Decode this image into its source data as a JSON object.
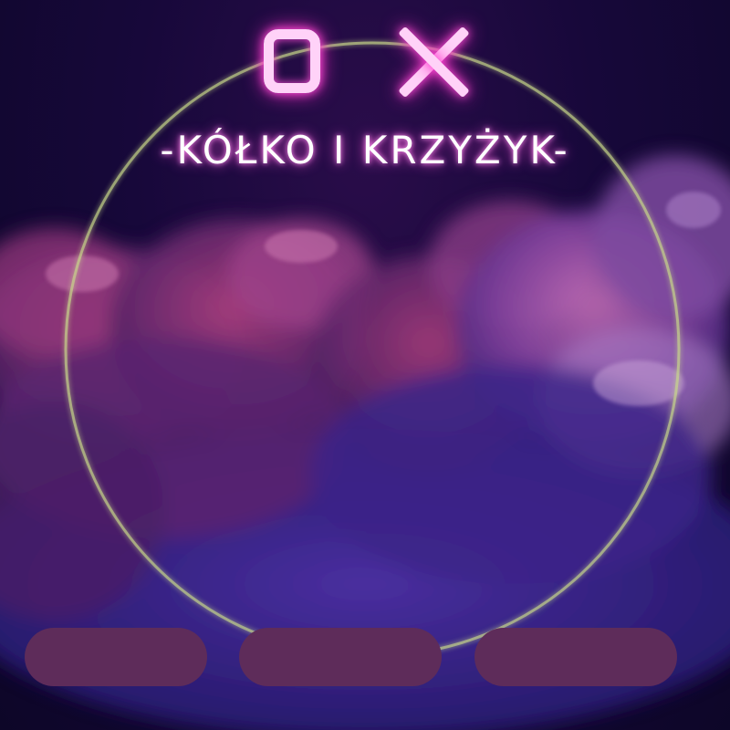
{
  "title": {
    "logo_letters": [
      "O",
      "X"
    ],
    "subtitle": "-KÓŁKO I KRZYŻYK-"
  },
  "menu": {
    "buttons": [
      {
        "label": ""
      },
      {
        "label": ""
      },
      {
        "label": ""
      }
    ]
  },
  "colors": {
    "background": "#12082e",
    "neon_pink": "#ff4fd8",
    "logo_fill": "#ffd2f8",
    "ring": "#c9d98a",
    "button": "#5e2c5a"
  }
}
